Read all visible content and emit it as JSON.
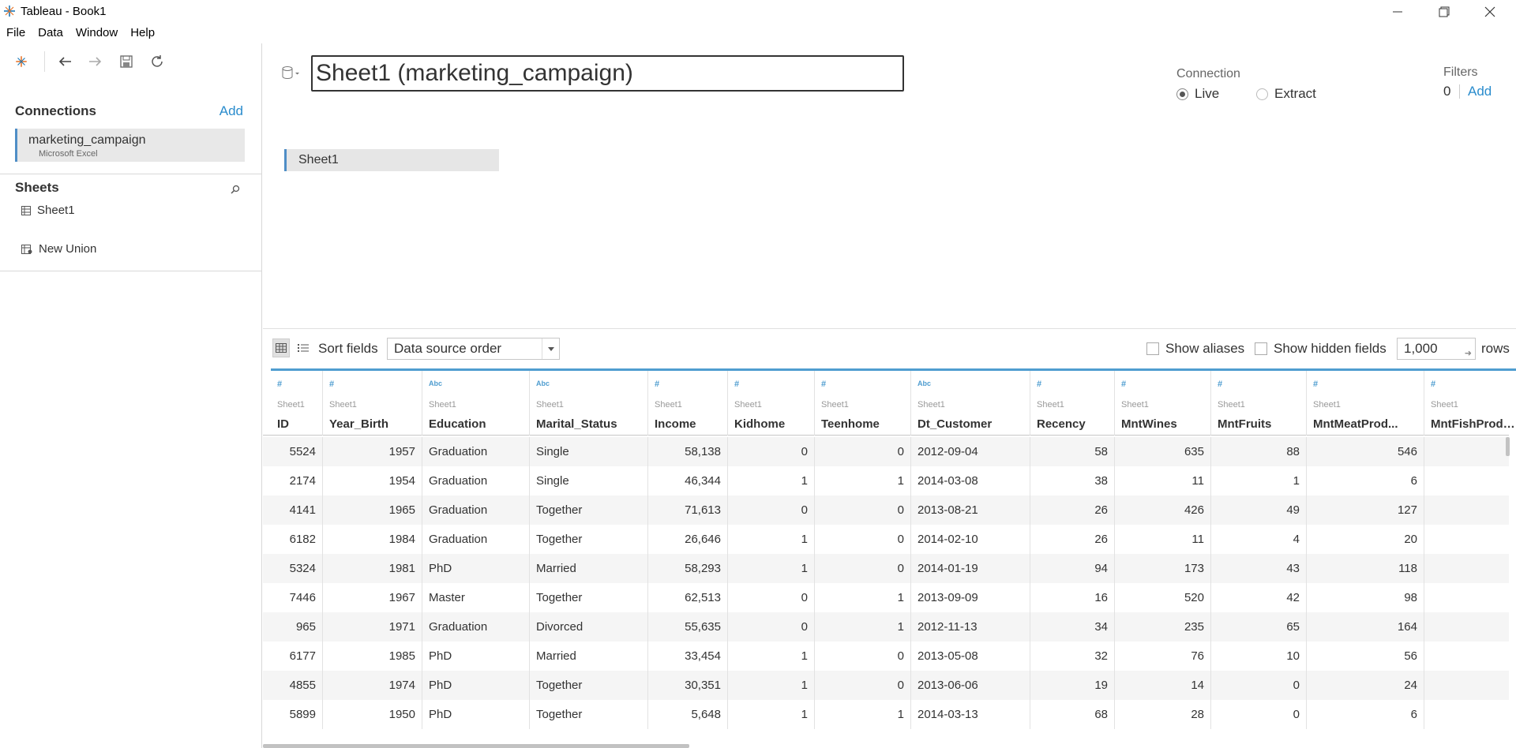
{
  "window": {
    "title": "Tableau - Book1"
  },
  "menu": [
    "File",
    "Data",
    "Window",
    "Help"
  ],
  "left": {
    "connections_title": "Connections",
    "connections_add": "Add",
    "connection": {
      "name": "marketing_campaign",
      "type": "Microsoft Excel"
    },
    "sheets_title": "Sheets",
    "sheets": [
      "Sheet1"
    ],
    "new_union": "New Union"
  },
  "datasource": {
    "title": "Sheet1 (marketing_campaign)",
    "connection_label": "Connection",
    "live": "Live",
    "extract": "Extract",
    "filters_label": "Filters",
    "filters_count": "0",
    "filters_add": "Add",
    "canvas_sheet": "Sheet1"
  },
  "grid_toolbar": {
    "sort_label": "Sort fields",
    "sort_value": "Data source order",
    "show_aliases": "Show aliases",
    "show_hidden": "Show hidden fields",
    "rows_value": "1,000",
    "rows_label": "rows"
  },
  "columns": [
    {
      "type": "#",
      "src": "Sheet1",
      "name": "ID"
    },
    {
      "type": "#",
      "src": "Sheet1",
      "name": "Year_Birth"
    },
    {
      "type": "Abc",
      "src": "Sheet1",
      "name": "Education"
    },
    {
      "type": "Abc",
      "src": "Sheet1",
      "name": "Marital_Status"
    },
    {
      "type": "#",
      "src": "Sheet1",
      "name": "Income"
    },
    {
      "type": "#",
      "src": "Sheet1",
      "name": "Kidhome"
    },
    {
      "type": "#",
      "src": "Sheet1",
      "name": "Teenhome"
    },
    {
      "type": "Abc",
      "src": "Sheet1",
      "name": "Dt_Customer"
    },
    {
      "type": "#",
      "src": "Sheet1",
      "name": "Recency"
    },
    {
      "type": "#",
      "src": "Sheet1",
      "name": "MntWines"
    },
    {
      "type": "#",
      "src": "Sheet1",
      "name": "MntFruits"
    },
    {
      "type": "#",
      "src": "Sheet1",
      "name": "MntMeatProd..."
    },
    {
      "type": "#",
      "src": "Sheet1",
      "name": "MntFishProdu..."
    }
  ],
  "rows": [
    [
      "5524",
      "1957",
      "Graduation",
      "Single",
      "58,138",
      "0",
      "0",
      "2012-09-04",
      "58",
      "635",
      "88",
      "546",
      ""
    ],
    [
      "2174",
      "1954",
      "Graduation",
      "Single",
      "46,344",
      "1",
      "1",
      "2014-03-08",
      "38",
      "11",
      "1",
      "6",
      ""
    ],
    [
      "4141",
      "1965",
      "Graduation",
      "Together",
      "71,613",
      "0",
      "0",
      "2013-08-21",
      "26",
      "426",
      "49",
      "127",
      ""
    ],
    [
      "6182",
      "1984",
      "Graduation",
      "Together",
      "26,646",
      "1",
      "0",
      "2014-02-10",
      "26",
      "11",
      "4",
      "20",
      ""
    ],
    [
      "5324",
      "1981",
      "PhD",
      "Married",
      "58,293",
      "1",
      "0",
      "2014-01-19",
      "94",
      "173",
      "43",
      "118",
      ""
    ],
    [
      "7446",
      "1967",
      "Master",
      "Together",
      "62,513",
      "0",
      "1",
      "2013-09-09",
      "16",
      "520",
      "42",
      "98",
      ""
    ],
    [
      "965",
      "1971",
      "Graduation",
      "Divorced",
      "55,635",
      "0",
      "1",
      "2012-11-13",
      "34",
      "235",
      "65",
      "164",
      ""
    ],
    [
      "6177",
      "1985",
      "PhD",
      "Married",
      "33,454",
      "1",
      "0",
      "2013-05-08",
      "32",
      "76",
      "10",
      "56",
      ""
    ],
    [
      "4855",
      "1974",
      "PhD",
      "Together",
      "30,351",
      "1",
      "0",
      "2013-06-06",
      "19",
      "14",
      "0",
      "24",
      ""
    ],
    [
      "5899",
      "1950",
      "PhD",
      "Together",
      "5,648",
      "1",
      "1",
      "2014-03-13",
      "68",
      "28",
      "0",
      "6",
      ""
    ]
  ],
  "colors": {
    "accent": "#2a8ccd",
    "selection_bar": "#4f8ec6",
    "grid_top": "#4f9dd0"
  }
}
